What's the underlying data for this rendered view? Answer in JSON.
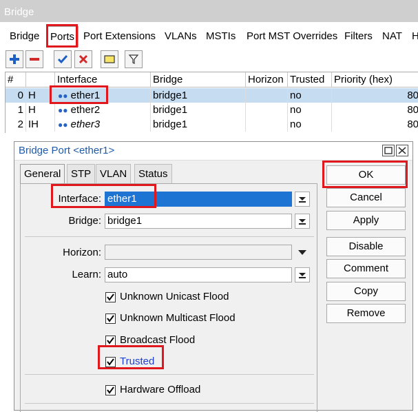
{
  "window": {
    "title": "Bridge"
  },
  "tabs": [
    {
      "label": "Bridge"
    },
    {
      "label": "Ports"
    },
    {
      "label": "Port Extensions"
    },
    {
      "label": "VLANs"
    },
    {
      "label": "MSTIs"
    },
    {
      "label": "Port MST Overrides"
    },
    {
      "label": "Filters"
    },
    {
      "label": "NAT"
    },
    {
      "label": "H"
    }
  ],
  "toolbar": {
    "icons": [
      "plus-icon",
      "minus-icon",
      "check-icon",
      "x-icon",
      "comment-icon",
      "filter-icon"
    ],
    "colors": {
      "plus": "#1e5fc4",
      "minus": "#d12a2a",
      "check": "#1e5fc4",
      "x": "#d12a2a"
    }
  },
  "table": {
    "columns": [
      "#",
      "",
      "Interface",
      "Bridge",
      "Horizon",
      "Trusted",
      "Priority (hex)"
    ],
    "rows": [
      {
        "num": "0",
        "flags": "H",
        "interface": "ether1",
        "bridge": "bridge1",
        "horizon": "",
        "trusted": "no",
        "priority": "80"
      },
      {
        "num": "1",
        "flags": "H",
        "interface": "ether2",
        "bridge": "bridge1",
        "horizon": "",
        "trusted": "no",
        "priority": "80"
      },
      {
        "num": "2",
        "flags": "IH",
        "interface": "ether3",
        "bridge": "bridge1",
        "horizon": "",
        "trusted": "no",
        "priority": "80"
      }
    ]
  },
  "dialog": {
    "title": "Bridge Port <ether1>",
    "tabs": [
      "General",
      "STP",
      "VLAN",
      "Status"
    ],
    "fields": {
      "interface_label": "Interface:",
      "interface_value": "ether1",
      "bridge_label": "Bridge:",
      "bridge_value": "bridge1",
      "horizon_label": "Horizon:",
      "horizon_value": "",
      "learn_label": "Learn:",
      "learn_value": "auto"
    },
    "checkboxes": [
      {
        "label": "Unknown Unicast Flood",
        "checked": true
      },
      {
        "label": "Unknown Multicast Flood",
        "checked": true
      },
      {
        "label": "Broadcast Flood",
        "checked": true
      },
      {
        "label": "Trusted",
        "checked": true
      },
      {
        "label": "Hardware Offload",
        "checked": true
      }
    ],
    "buttons": [
      "OK",
      "Cancel",
      "Apply",
      "Disable",
      "Comment",
      "Copy",
      "Remove"
    ]
  },
  "colors": {
    "highlight": "#e0181e",
    "selection": "#1e74d2",
    "accent_text": "#1e5aa8"
  }
}
